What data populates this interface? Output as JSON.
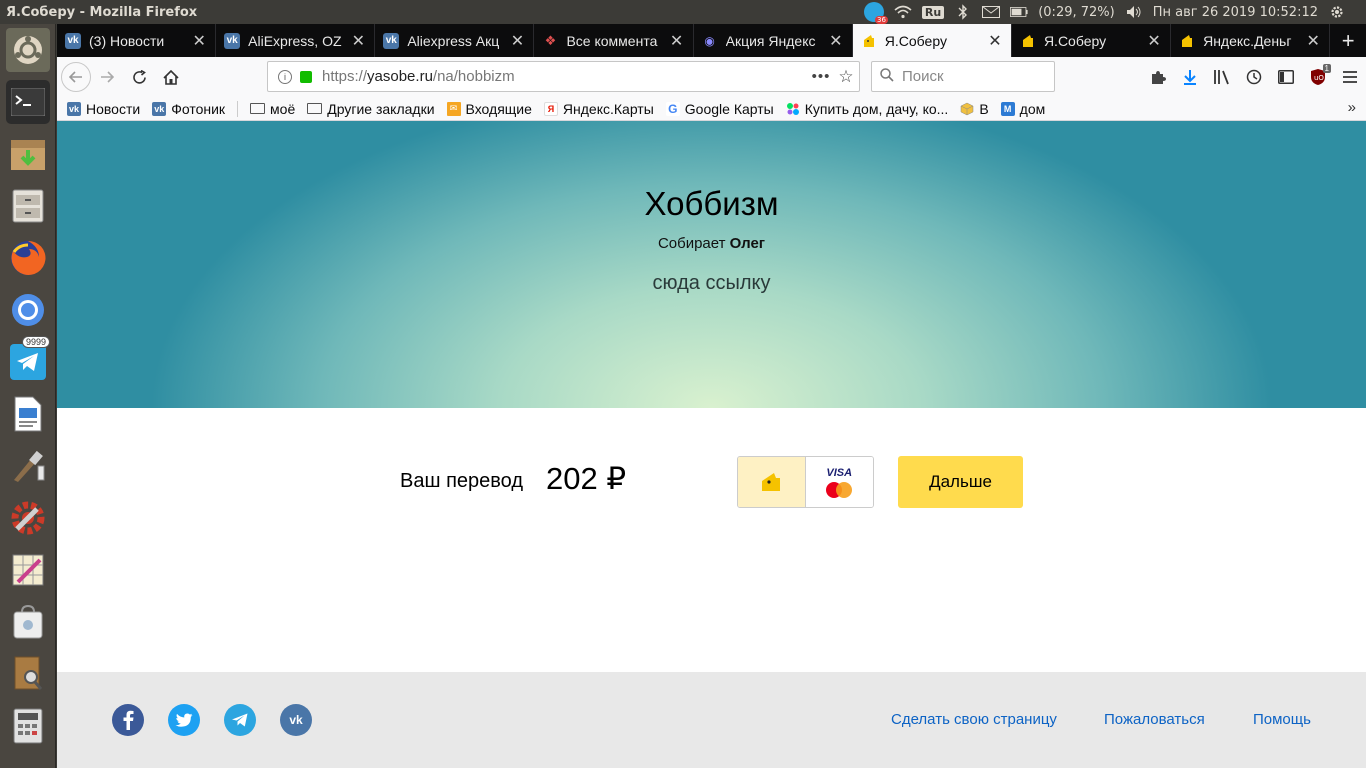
{
  "system": {
    "window_title": "Я.Соберу - Mozilla Firefox",
    "telegram_badge": "36",
    "keyboard_layout": "Ru",
    "battery": "(0:29, 72%)",
    "clock": "Пн авг 26 2019 10:52:12"
  },
  "launcher": {
    "telegram_badge": "9999"
  },
  "tabs": [
    {
      "label": "(3) Новости",
      "icon": "vk-icon"
    },
    {
      "label": "AliExpress, OZ",
      "icon": "vk-icon"
    },
    {
      "label": "Aliexpress Акц",
      "icon": "vk-icon"
    },
    {
      "label": "Все коммента",
      "icon": "gift-icon"
    },
    {
      "label": "Акция Яндекс",
      "icon": "mask-icon"
    },
    {
      "label": "Я.Соберу",
      "icon": "yandex-wallet-icon",
      "active": true
    },
    {
      "label": "Я.Соберу",
      "icon": "yandex-wallet-icon"
    },
    {
      "label": "Яндекс.Деньг",
      "icon": "yandex-wallet-icon"
    }
  ],
  "urlbar": {
    "url_prefix": "https://",
    "url_domain": "yasobe.ru",
    "url_path": "/na/hobbizm"
  },
  "search": {
    "placeholder": "Поиск"
  },
  "ublock_count": "1",
  "bookmarks": [
    {
      "label": "Новости",
      "icon": "vk-icon"
    },
    {
      "label": "Фотоник",
      "icon": "vk-icon"
    },
    {
      "label": "моё",
      "icon": "folder-icon"
    },
    {
      "label": "Другие закладки",
      "icon": "folder-icon"
    },
    {
      "label": "Входящие",
      "icon": "mail-icon"
    },
    {
      "label": "Яндекс.Карты",
      "icon": "yandex-icon"
    },
    {
      "label": "Google Карты",
      "icon": "google-icon"
    },
    {
      "label": "Купить дом, дачу, ко...",
      "icon": "avito-icon"
    },
    {
      "label": "В",
      "icon": "cube-icon"
    },
    {
      "label": "дом",
      "icon": "m-icon"
    }
  ],
  "hero": {
    "title": "Хоббизм",
    "collector_prefix": "Собирает",
    "collector_name": "Олег",
    "description": "сюда ссылку"
  },
  "payment": {
    "label": "Ваш перевод",
    "amount": "202 ₽",
    "visa_label": "VISA",
    "next_button": "Дальше"
  },
  "footer": {
    "links": [
      "Сделать свою страницу",
      "Пожаловаться",
      "Помощь"
    ]
  },
  "colors": {
    "accent_button": "#ffdb4d",
    "link": "#0d63c5"
  }
}
